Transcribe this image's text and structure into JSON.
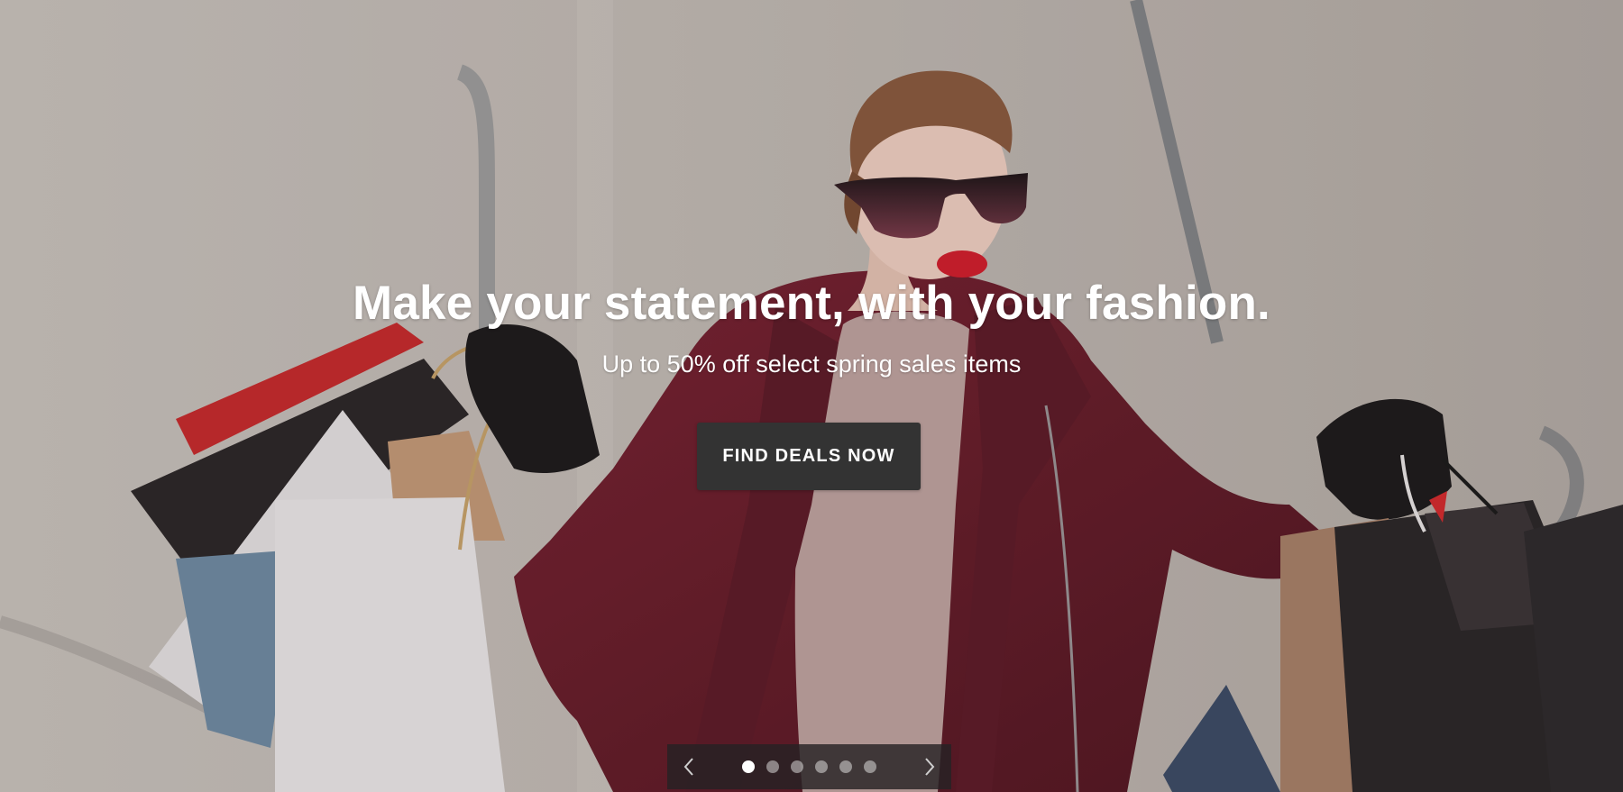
{
  "hero": {
    "title": "Make your statement, with your fashion.",
    "subtitle": "Up to 50% off select spring sales items",
    "cta_label": "FIND DEALS NOW",
    "image_description": "shopping-woman-photo"
  },
  "carousel": {
    "slide_count": 6,
    "active_index": 0,
    "prev_icon": "chevron-left-icon",
    "next_icon": "chevron-right-icon"
  },
  "colors": {
    "cta_background": "#333333",
    "cta_text": "#ffffff",
    "coat": "#6b1e2b",
    "controls_background": "#262224"
  }
}
